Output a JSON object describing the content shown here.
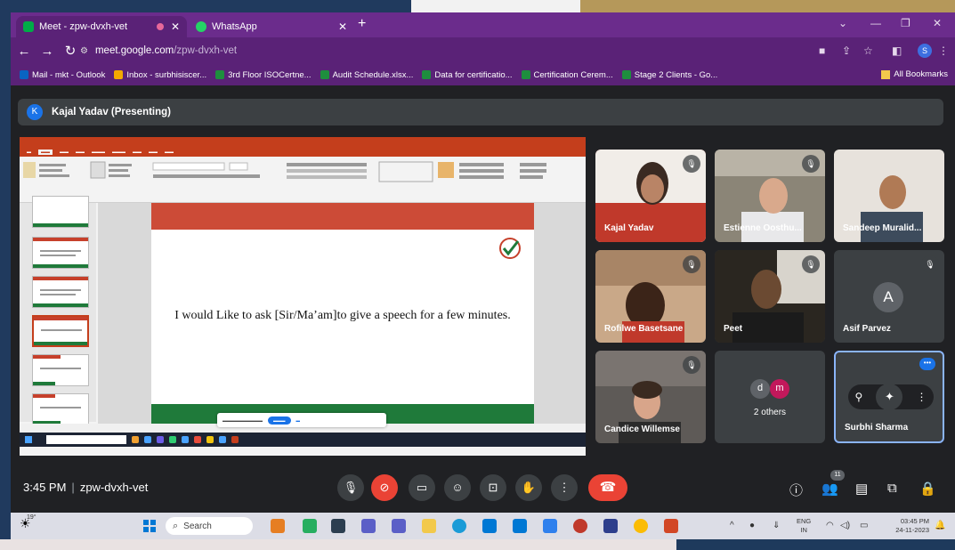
{
  "browser": {
    "tabs": [
      {
        "title": "Meet - zpw-dvxh-vet",
        "active": true
      },
      {
        "title": "WhatsApp",
        "active": false
      }
    ],
    "url_host": "meet.google.com",
    "url_path": "/zpw-dvxh-vet",
    "profile_initial": "S",
    "bookmarks": [
      "Mail - mkt - Outlook",
      "Inbox - surbhisiscer...",
      "3rd Floor ISOCertne...",
      "Audit Schedule.xlsx...",
      "Data for certificatio...",
      "Certification Cerem...",
      "Stage 2 Clients - Go..."
    ],
    "all_bookmarks": "All Bookmarks"
  },
  "meet": {
    "presenter_initial": "K",
    "presenter_label": "Kajal Yadav (Presenting)",
    "slide_text": "I would Like to ask  [Sir/Ma’am]to give a speech for a few minutes.",
    "participants": [
      {
        "name": "Kajal Yadav"
      },
      {
        "name": "Estienne Oosthu..."
      },
      {
        "name": "Sandeep Muralid..."
      },
      {
        "name": "Rofilwe Basetsane"
      },
      {
        "name": "Peet"
      },
      {
        "name": "Asif Parvez",
        "initial": "A"
      },
      {
        "name": "Candice Willemse"
      },
      {
        "name": "2 others",
        "initials": [
          "d",
          "m"
        ]
      },
      {
        "name": "Surbhi Sharma"
      }
    ],
    "time": "3:45 PM",
    "meeting_code": "zpw-dvxh-vet",
    "participant_count": "11"
  },
  "taskbar": {
    "weather_temp": "19°",
    "search_placeholder": "Search",
    "lang_top": "ENG",
    "lang_bottom": "IN",
    "time": "03:45 PM",
    "date": "24-11-2023"
  },
  "colors": {
    "chrome_purple": "#6b2c8c",
    "meet_bg": "#202124",
    "end_call_red": "#ea4335",
    "accent_blue": "#1a73e8"
  }
}
